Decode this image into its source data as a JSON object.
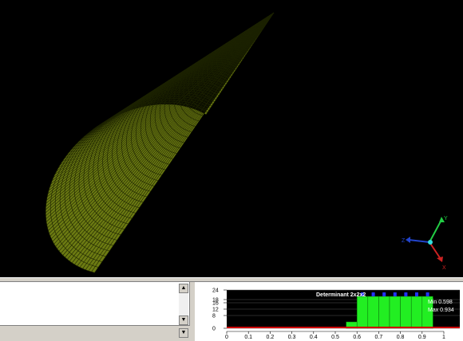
{
  "viewport": {
    "background": "#000000",
    "mesh_color": "#6b7a12",
    "mesh_line_color": "#1c2200",
    "axes": {
      "x_label": "X",
      "y_label": "Y",
      "z_label": "Z",
      "x_color": "#cc2222",
      "y_color": "#22cc44",
      "z_color": "#2244cc",
      "center_color": "#33dddd"
    }
  },
  "console": {
    "scroll_up": "▲",
    "scroll_down": "▼",
    "bar_button": "▼"
  },
  "chart_data": {
    "type": "bar",
    "title": "Determinant 2x2x2",
    "stats": {
      "min_label": "Min 0.598",
      "max_label": "Max 0.934"
    },
    "xlim": [
      0,
      1
    ],
    "ylim": [
      0,
      24
    ],
    "x_ticks": [
      "0",
      "0.1",
      "0.2",
      "0.3",
      "0.4",
      "0.5",
      "0.6",
      "0.7",
      "0.8",
      "0.9",
      "1"
    ],
    "y_ticks": [
      "0",
      "8",
      "12",
      "16",
      "18",
      "24"
    ],
    "bins": [
      {
        "x0": 0.55,
        "x1": 0.6,
        "value": 4
      },
      {
        "x0": 0.6,
        "x1": 0.65,
        "value": 20
      },
      {
        "x0": 0.65,
        "x1": 0.7,
        "value": 20
      },
      {
        "x0": 0.7,
        "x1": 0.75,
        "value": 20
      },
      {
        "x0": 0.75,
        "x1": 0.8,
        "value": 20
      },
      {
        "x0": 0.8,
        "x1": 0.85,
        "value": 20
      },
      {
        "x0": 0.85,
        "x1": 0.9,
        "value": 20
      },
      {
        "x0": 0.9,
        "x1": 0.95,
        "value": 20
      }
    ],
    "marker_x": [
      0.625,
      0.675,
      0.725,
      0.775,
      0.825,
      0.875,
      0.925
    ],
    "baseline_color": "#cc0000",
    "bar_color": "#22ee22",
    "marker_color": "#2233ff"
  }
}
